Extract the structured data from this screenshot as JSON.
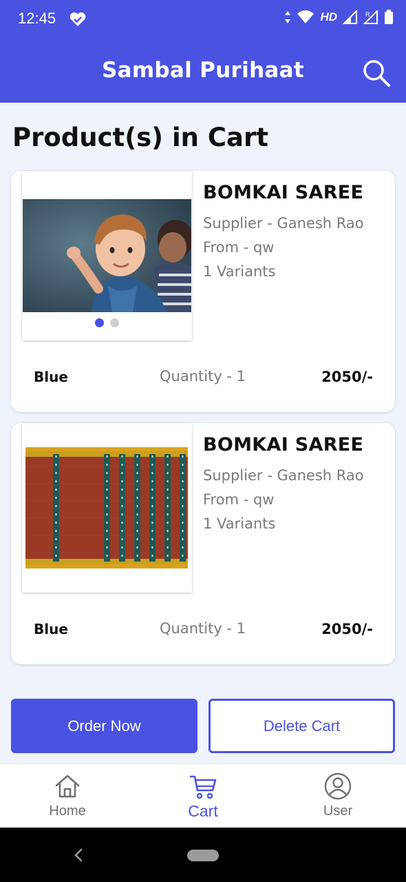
{
  "status_bar": {
    "time": "12:45",
    "network": "HD",
    "icons": [
      "heart-check-icon",
      "data-arrows-icon",
      "wifi-icon",
      "signal-icon",
      "signal-roaming-icon",
      "battery-icon"
    ]
  },
  "app_bar": {
    "title": "Sambal Purihaat",
    "search_icon": "search-icon"
  },
  "page": {
    "heading": "Product(s) in Cart"
  },
  "cart_items": [
    {
      "name": "BOMKAI SAREE",
      "supplier": "Supplier - Ganesh Rao",
      "from": "From - qw",
      "variants": "1 Variants",
      "color": "Blue",
      "quantity": "Quantity - 1",
      "price": "2050/-",
      "image": "child-photo",
      "carousel_dots": 2,
      "carousel_active": 1
    },
    {
      "name": "BOMKAI SAREE",
      "supplier": "Supplier - Ganesh Rao",
      "from": "From - qw",
      "variants": "1 Variants",
      "color": "Blue",
      "quantity": "Quantity - 1",
      "price": "2050/-",
      "image": "saree-photo"
    }
  ],
  "actions": {
    "order_now": "Order Now",
    "delete_cart": "Delete Cart"
  },
  "bottom_nav": {
    "items": [
      {
        "label": "Home",
        "icon": "home-icon"
      },
      {
        "label": "Cart",
        "icon": "cart-icon",
        "active": true
      },
      {
        "label": "User",
        "icon": "user-icon"
      }
    ]
  },
  "colors": {
    "primary": "#4a52e2",
    "background": "#eff3fb",
    "muted_text": "#7a7a7a"
  }
}
